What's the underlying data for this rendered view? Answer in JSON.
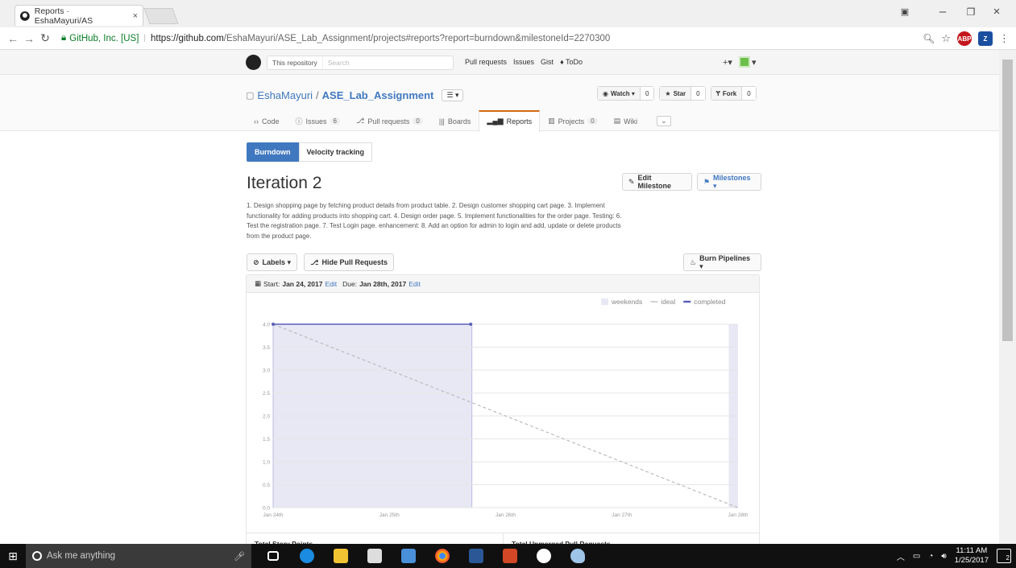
{
  "browser": {
    "tab_title": "Reports · EshaMayuri/AS",
    "tab_close": "×",
    "secure_label": "GitHub, Inc. [US]",
    "url_host": "https://github.com",
    "url_path": "/EshaMayuri/ASE_Lab_Assignment/projects#reports?report=burndown&milestoneId=2270300",
    "ext_abp": "ABP",
    "ext_z": "Z"
  },
  "gh": {
    "search_scope": "This repository",
    "search_placeholder": "Search",
    "nav": [
      "Pull requests",
      "Issues",
      "Gist",
      "♦ ToDo"
    ],
    "plus": "+▾",
    "avatar_caret": "▾"
  },
  "repo": {
    "owner": "EshaMayuri",
    "slash": "/",
    "name": "ASE_Lab_Assignment",
    "menu": "☰ ▾",
    "watch_label": "Watch ▾",
    "watch_count": "0",
    "star_label": "Star",
    "star_count": "0",
    "fork_label": "Fork",
    "fork_count": "0",
    "tabs": [
      {
        "label": "Code",
        "count": ""
      },
      {
        "label": "Issues",
        "count": "6"
      },
      {
        "label": "Pull requests",
        "count": "0"
      },
      {
        "label": "Boards",
        "count": ""
      },
      {
        "label": "Reports",
        "count": ""
      },
      {
        "label": "Projects",
        "count": "0"
      },
      {
        "label": "Wiki",
        "count": ""
      }
    ]
  },
  "report": {
    "tab_burndown": "Burndown",
    "tab_velocity": "Velocity tracking",
    "milestone_title": "Iteration 2",
    "edit_milestone": "Edit Milestone",
    "milestones": "Milestones ▾",
    "description": "1. Design shopping page by fetching product details from product table.  2. Design customer shopping cart page. 3. Implement functionality for adding products into shopping cart. 4. Design order page. 5. Implement functionalities for the order page.  Testing: 6. Test the registration page. 7. Test Login page.  enhancement: 8. Add an option for admin to login and add, update or delete products from the product page.",
    "labels_btn": "Labels ▾",
    "hide_pr_btn": "Hide Pull Requests",
    "burn_btn": "Burn Pipelines ▾",
    "start_label": "Start:",
    "start_date": "Jan 24, 2017",
    "due_label": "Due:",
    "due_date": "Jan 28th, 2017",
    "edit": "Edit",
    "stats_left": "Total Story Points",
    "stats_right": "Total Unmerged Pull Requests"
  },
  "chart_data": {
    "type": "line",
    "legend": [
      "weekends",
      "ideal",
      "completed"
    ],
    "legend_position": "top-right",
    "x_ticks": [
      "Jan 24th",
      "Jan 25th",
      "Jan 26th",
      "Jan 27th",
      "Jan 28th"
    ],
    "y_ticks": [
      "0.0",
      "0.5",
      "1.0",
      "1.5",
      "2.0",
      "2.5",
      "3.0",
      "3.5",
      "4.0"
    ],
    "ylim": [
      0,
      4
    ],
    "series": [
      {
        "name": "ideal",
        "x": [
          0,
          4
        ],
        "values": [
          4.0,
          0.0
        ]
      },
      {
        "name": "completed",
        "x": [
          0,
          1.7
        ],
        "values": [
          4.0,
          4.0
        ]
      }
    ],
    "shaded_ranges": [
      [
        0,
        1.71
      ],
      [
        3.92,
        4.0
      ]
    ],
    "colors": {
      "ideal": "#bbbbbb",
      "completed": "#5b5fb8",
      "weekends": "#e8e8f5",
      "grid": "#e5e5e5"
    }
  },
  "taskbar": {
    "search_placeholder": "Ask me anything",
    "time": "11:11 AM",
    "date": "1/25/2017",
    "notif_count": "2"
  }
}
